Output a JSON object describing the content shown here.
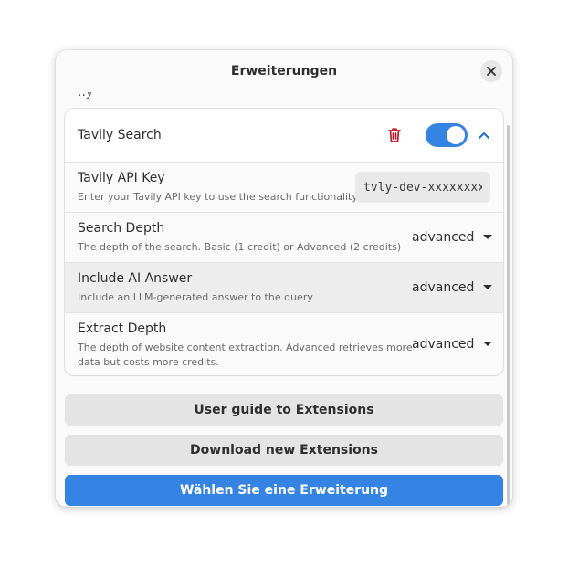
{
  "dialog": {
    "title": "Erweiterungen",
    "peek_text": "..y"
  },
  "extension": {
    "name": "Tavily Search",
    "enabled": true,
    "accent_color": "#3584e4",
    "delete_color": "#c01c28",
    "settings": {
      "api_key": {
        "title": "Tavily API Key",
        "subtitle": "Enter your Tavily API key to use the search functionality",
        "value": "tvly-dev-xxxxxxxxxx"
      },
      "search_depth": {
        "title": "Search Depth",
        "subtitle": "The depth of the search. Basic (1 credit) or Advanced (2 credits)",
        "value": "advanced"
      },
      "include_ai_answer": {
        "title": "Include AI Answer",
        "subtitle": "Include an LLM-generated answer to the query",
        "value": "advanced"
      },
      "extract_depth": {
        "title": "Extract Depth",
        "subtitle_line1": "The depth of website content extraction. Advanced retrieves more",
        "subtitle_line2": "data but costs more credits.",
        "value": "advanced"
      }
    }
  },
  "buttons": {
    "user_guide": "User guide to Extensions",
    "download": "Download new Extensions",
    "choose": "Wählen Sie eine Erweiterung"
  },
  "icons": {
    "close": "close-icon",
    "delete": "trash-icon",
    "collapse": "chevron-up-icon",
    "dropdown": "caret-down-icon"
  }
}
